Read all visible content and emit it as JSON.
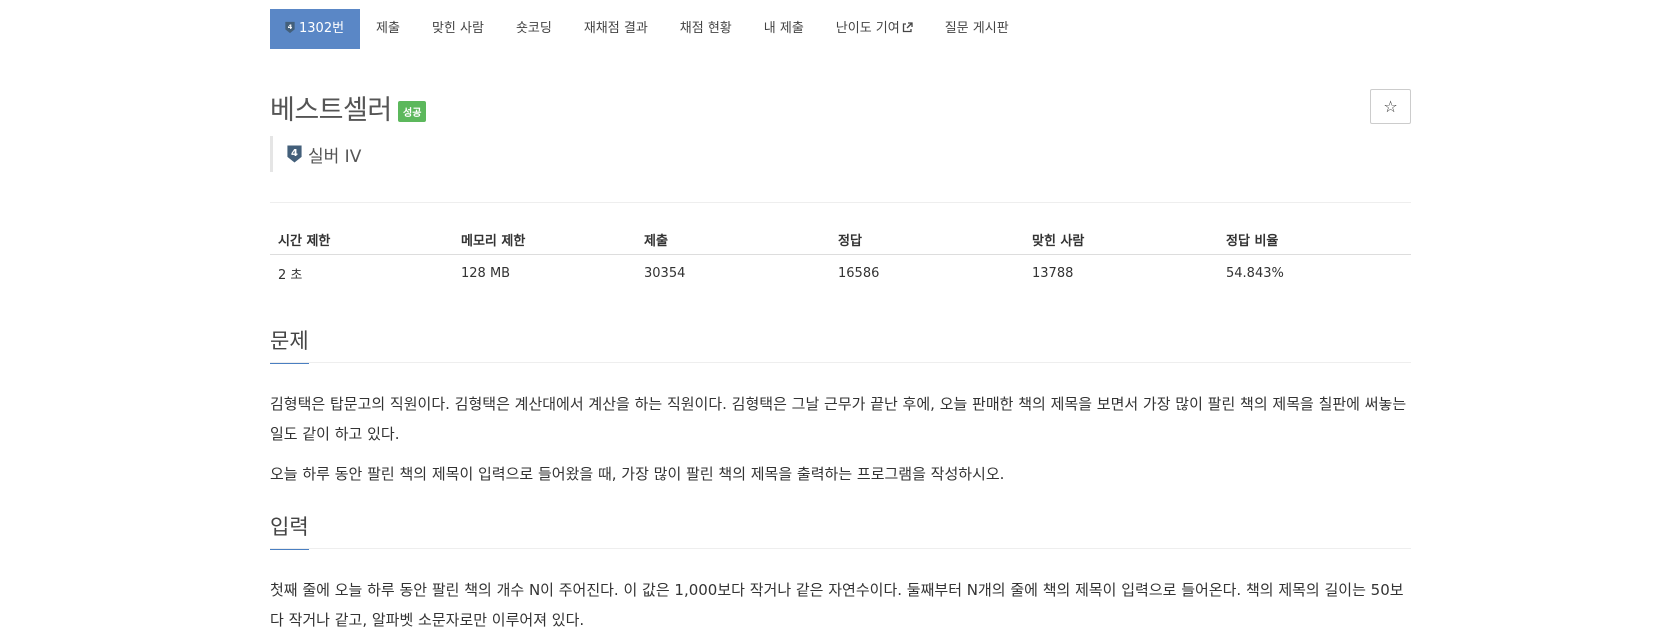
{
  "nav": {
    "tabs": [
      {
        "label": "1302번",
        "tier_num": "4",
        "active": true
      },
      {
        "label": "제출"
      },
      {
        "label": "맞힌 사람"
      },
      {
        "label": "숏코딩"
      },
      {
        "label": "재채점 결과"
      },
      {
        "label": "채점 현황"
      },
      {
        "label": "내 제출"
      },
      {
        "label": "난이도 기여"
      },
      {
        "label": "질문 게시판"
      }
    ]
  },
  "problem": {
    "title": "베스트셀러",
    "status_badge": "성공",
    "tier_num": "4",
    "tier_label": "실버 IV",
    "star_icon": "☆"
  },
  "info_table": {
    "headers": [
      "시간 제한",
      "메모리 제한",
      "제출",
      "정답",
      "맞힌 사람",
      "정답 비율"
    ],
    "values": [
      "2 초",
      "128 MB",
      "30354",
      "16586",
      "13788",
      "54.843%"
    ]
  },
  "sections": {
    "problem": {
      "heading": "문제",
      "paragraphs": [
        "김형택은 탑문고의 직원이다. 김형택은 계산대에서 계산을 하는 직원이다. 김형택은 그날 근무가 끝난 후에, 오늘 판매한 책의 제목을 보면서 가장 많이 팔린 책의 제목을 칠판에 써놓는 일도 같이 하고 있다.",
        "오늘 하루 동안 팔린 책의 제목이 입력으로 들어왔을 때, 가장 많이 팔린 책의 제목을 출력하는 프로그램을 작성하시오."
      ]
    },
    "input": {
      "heading": "입력",
      "paragraphs": [
        "첫째 줄에 오늘 하루 동안 팔린 책의 개수 N이 주어진다. 이 값은 1,000보다 작거나 같은 자연수이다. 둘째부터 N개의 줄에 책의 제목이 입력으로 들어온다. 책의 제목의 길이는 50보다 작거나 같고, 알파벳 소문자로만 이루어져 있다."
      ]
    }
  },
  "colors": {
    "active_tab": "#5a87c6",
    "success_badge": "#5cb85c",
    "tier_silver": "#435f7a",
    "section_underline": "#4a7fc1"
  }
}
